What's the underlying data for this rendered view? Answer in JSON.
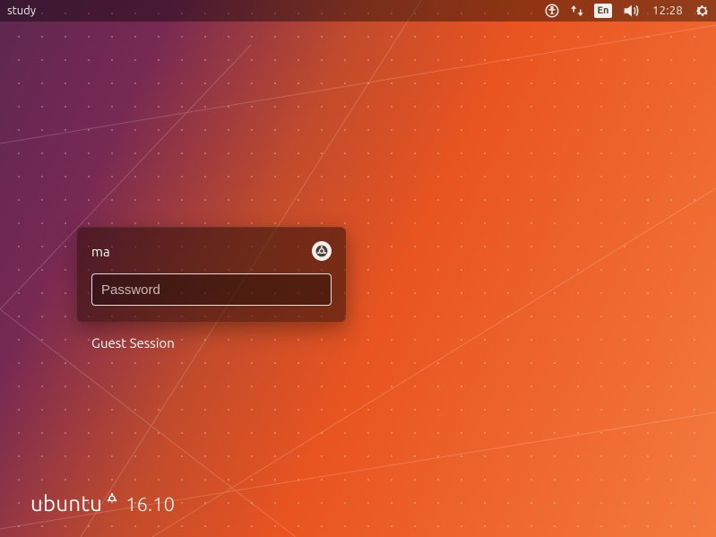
{
  "panel": {
    "hostname": "study",
    "language": "En",
    "clock": "12:28"
  },
  "login": {
    "username": "ma",
    "password_placeholder": "Password",
    "guest_label": "Guest Session"
  },
  "brand": {
    "name": "ubuntu",
    "version": "16.10"
  }
}
